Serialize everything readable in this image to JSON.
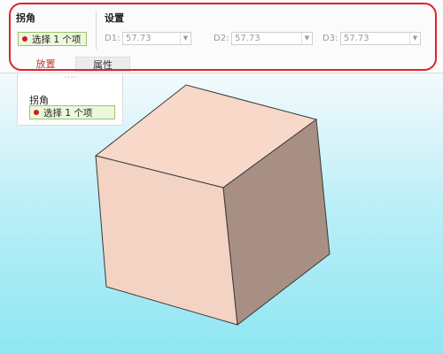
{
  "dashboard": {
    "corner_group": {
      "title": "拐角",
      "collector": "选择 1 个项"
    },
    "settings_group": {
      "title": "设置",
      "fields": [
        {
          "label": "D1:",
          "value": "57.73"
        },
        {
          "label": "D2:",
          "value": "57.73"
        },
        {
          "label": "D3:",
          "value": "57.73"
        }
      ]
    },
    "tabs": [
      {
        "label": "放置",
        "active": true
      },
      {
        "label": "属性",
        "active": false
      }
    ]
  },
  "placement_panel": {
    "grip": "····",
    "title": "拐角",
    "collector": "选择 1 个项"
  },
  "colors": {
    "highlight_border": "#d9262b",
    "collector_bg": "#edf7dc",
    "cube_front": "#f3d3c4",
    "cube_top": "#f7d8c9",
    "cube_side": "#a88f84"
  },
  "icons": {
    "required_indicator": "red-dot-icon",
    "dropdown": "chevron-down-icon"
  }
}
